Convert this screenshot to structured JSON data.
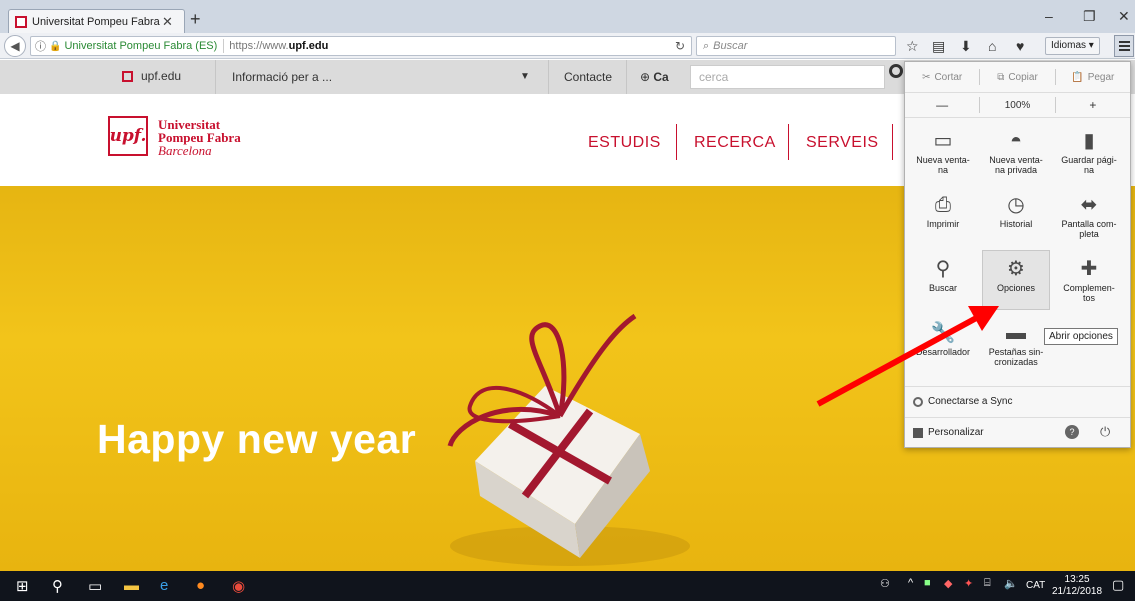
{
  "browser": {
    "tab": {
      "title": "Universitat Pompeu Fabra ..."
    },
    "new_tab": "+",
    "window_controls": {
      "minimize": "–",
      "maximize": "❐",
      "close": "✕"
    },
    "url": {
      "identity": "Universitat Pompeu Fabra (ES)",
      "prefix": "https://www.",
      "domain": "upf.edu"
    },
    "search_placeholder": "Buscar",
    "idiomas": "Idiomas ▾"
  },
  "site_bar": {
    "home": "upf.edu",
    "info_dropdown": "Informació per a ...",
    "contact": "Contacte",
    "lang": "Ca",
    "search_placeholder": "cerca"
  },
  "header": {
    "logo_abbr": "upf.",
    "logo_line1": "Universitat",
    "logo_line2": "Pompeu Fabra",
    "logo_line3": "Barcelona",
    "nav": [
      "ESTUDIS",
      "RECERCA",
      "SERVEIS"
    ]
  },
  "hero": {
    "text": "Happy new year"
  },
  "menu": {
    "edit": {
      "cut": "Cortar",
      "copy": "Copiar",
      "paste": "Pegar"
    },
    "zoom": {
      "minus": "—",
      "value": "100%",
      "plus": "+"
    },
    "items": [
      {
        "label": "Nueva venta-na",
        "icon": "window-icon"
      },
      {
        "label": "Nueva venta-na privada",
        "icon": "mask-icon"
      },
      {
        "label": "Guardar pági-na",
        "icon": "page-icon"
      },
      {
        "label": "Imprimir",
        "icon": "printer-icon"
      },
      {
        "label": "Historial",
        "icon": "clock-icon"
      },
      {
        "label": "Pantalla com-pleta",
        "icon": "fullscreen-icon"
      },
      {
        "label": "Buscar",
        "icon": "search-icon"
      },
      {
        "label": "Opciones",
        "icon": "gear-icon"
      },
      {
        "label": "Complemen-tos",
        "icon": "puzzle-icon"
      },
      {
        "label": "Desarrollador",
        "icon": "wrench-icon"
      },
      {
        "label": "Pestañas sin-cronizadas",
        "icon": "synced-tabs-icon"
      }
    ],
    "tooltip": "Abrir opciones",
    "sync": "Conectarse a Sync",
    "customize": "Personalizar"
  },
  "taskbar": {
    "lang": "CAT",
    "time": "13:25",
    "date": "21/12/2018"
  },
  "colors": {
    "brand_red": "#c8102e",
    "hero_yellow": "#f2c41a",
    "arrow_red": "#ff0000"
  }
}
